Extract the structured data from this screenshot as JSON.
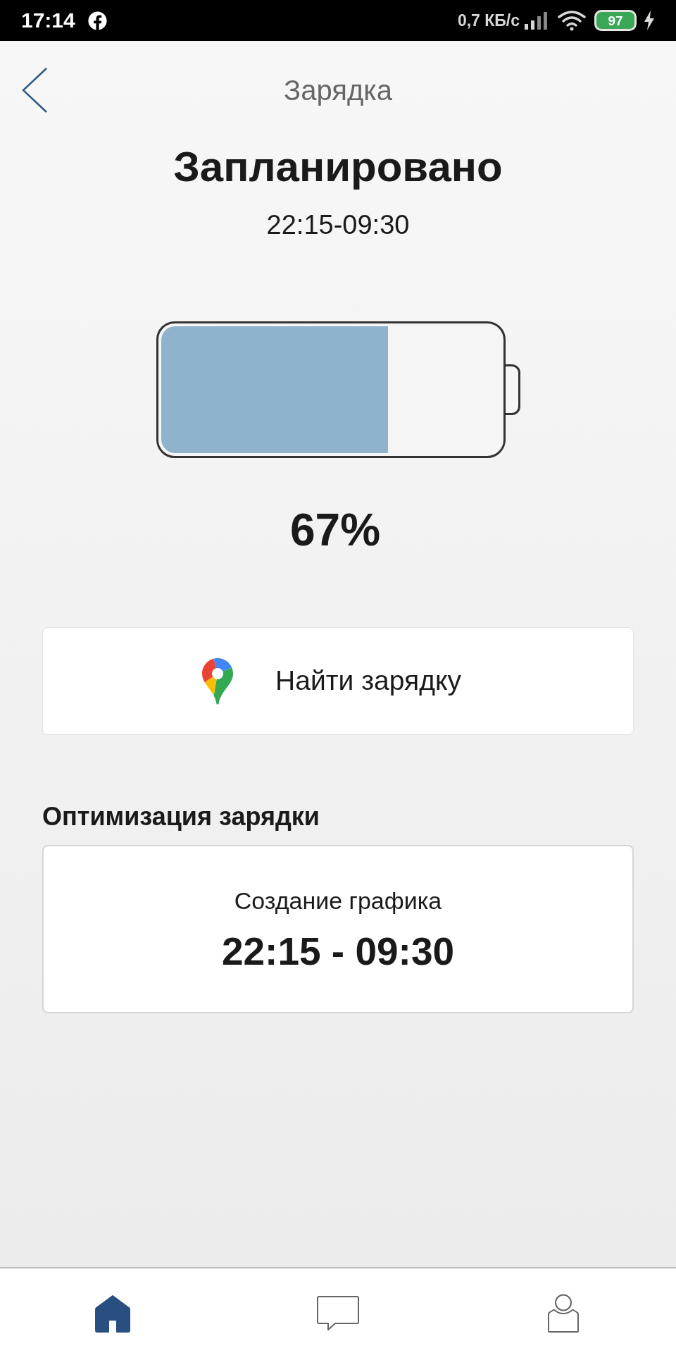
{
  "status_bar": {
    "time": "17:14",
    "network_speed": "0,7 КБ/с",
    "battery": "97",
    "charging": true
  },
  "header": {
    "title": "Зарядка"
  },
  "status": {
    "title": "Запланировано",
    "time_range": "22:15-09:30"
  },
  "battery": {
    "level": 0.67,
    "reading": "67%"
  },
  "find_button": {
    "label": "Найти зарядку"
  },
  "optimization": {
    "heading": "Оптимизация зарядки",
    "card_title": "Создание графика",
    "card_value": "22:15 - 09:30"
  },
  "bottom_nav": [
    {
      "kind": "home",
      "selected": true
    },
    {
      "kind": "chat",
      "selected": false
    },
    {
      "kind": "profile",
      "selected": false
    }
  ]
}
